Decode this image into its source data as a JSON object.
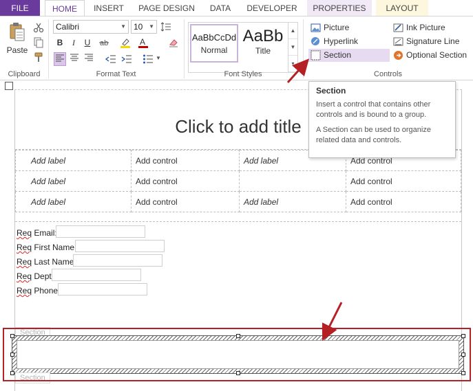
{
  "tabs": [
    {
      "label": "FILE"
    },
    {
      "label": "HOME"
    },
    {
      "label": "INSERT"
    },
    {
      "label": "PAGE DESIGN"
    },
    {
      "label": "DATA"
    },
    {
      "label": "DEVELOPER"
    },
    {
      "label": "PROPERTIES"
    },
    {
      "label": "LAYOUT"
    }
  ],
  "clipboard": {
    "paste_label": "Paste",
    "group_label": "Clipboard"
  },
  "format_text": {
    "font_name": "Calibri",
    "font_size": "10",
    "bold": "B",
    "italic": "I",
    "underline": "U",
    "group_label": "Format Text",
    "highlight_color": "#f5d800",
    "font_color": "#c00000"
  },
  "font_styles": {
    "normal_preview": "AaBbCcDd",
    "normal_label": "Normal",
    "title_preview": "AaBb",
    "title_label": "Title",
    "group_label": "Font Styles"
  },
  "controls": {
    "items": [
      "Picture",
      "Hyperlink",
      "Section",
      "Ink Picture",
      "Signature Line",
      "Optional Section"
    ],
    "group_label": "Controls"
  },
  "tooltip": {
    "title": "Section",
    "line1": "Insert a control that contains other controls and is bound to a group.",
    "line2": "A Section can be used to organize related data and controls."
  },
  "form": {
    "title": "Click to add title",
    "rows": [
      [
        "Add label",
        "Add control",
        "Add label",
        "Add control"
      ],
      [
        "Add label",
        "Add control",
        "",
        "Add control"
      ],
      [
        "Add label",
        "Add control",
        "Add label",
        "Add control"
      ]
    ],
    "fields": [
      {
        "prefix": "Req",
        "rest": " Email:"
      },
      {
        "prefix": "Req",
        "rest": " First Name:"
      },
      {
        "prefix": "Req",
        "rest": " Last Name:"
      },
      {
        "prefix": "Req",
        "rest": " Dept:"
      },
      {
        "prefix": "Req",
        "rest": " Phone:"
      }
    ],
    "section_tag": "Section"
  },
  "colors": {
    "accent": "#6a3a9c",
    "highlight_frame": "#b52025",
    "arrow": "#b52025"
  }
}
